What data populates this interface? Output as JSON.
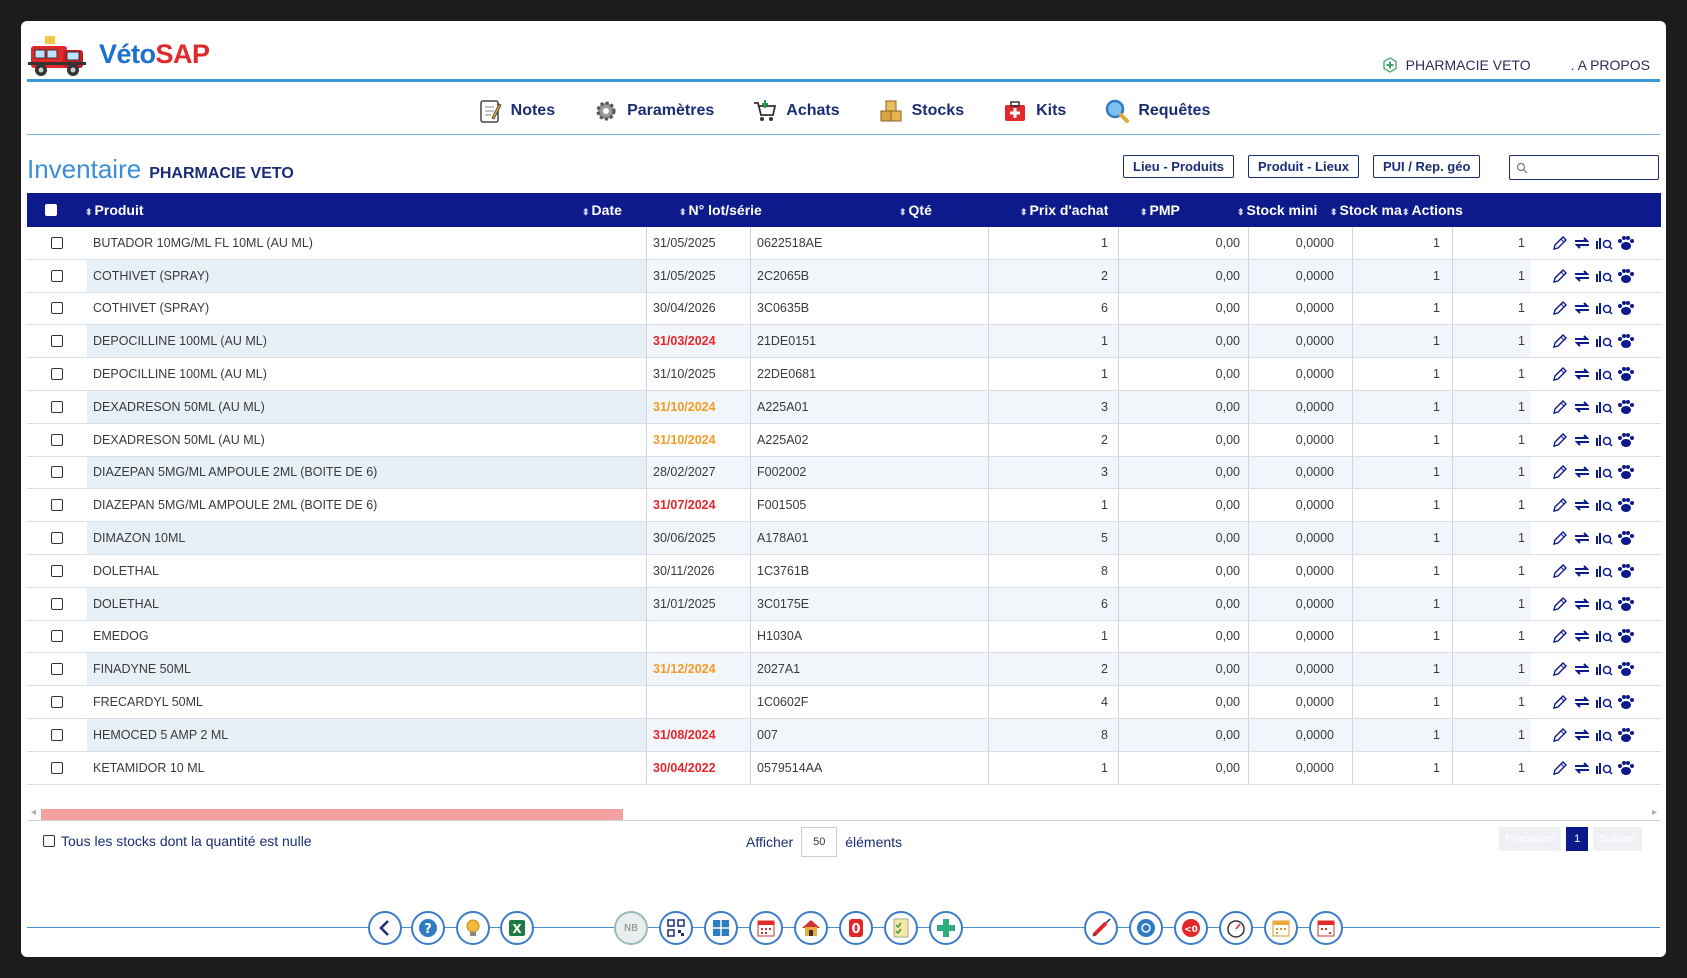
{
  "app": {
    "logo_a": "Véto",
    "logo_b": "SAP"
  },
  "top_links": {
    "pharmacy": "PHARMACIE VETO",
    "about": ". A PROPOS"
  },
  "nav": [
    {
      "label": "Notes",
      "icon": "notepad-icon"
    },
    {
      "label": "Paramètres",
      "icon": "gear-icon"
    },
    {
      "label": "Achats",
      "icon": "cart-icon"
    },
    {
      "label": "Stocks",
      "icon": "boxes-icon"
    },
    {
      "label": "Kits",
      "icon": "first-aid-kit-icon"
    },
    {
      "label": "Requêtes",
      "icon": "magnifier-icon"
    }
  ],
  "page": {
    "title": "Inventaire",
    "subtitle": "PHARMACIE VETO"
  },
  "toolbar_buttons": {
    "lieu_produits": "Lieu - Produits",
    "produit_lieux": "Produit - Lieux",
    "pui": "PUI / Rep. géo"
  },
  "search": {
    "placeholder": ""
  },
  "columns": [
    "Produit",
    "Date",
    "N° lot/série",
    "Qté",
    "Prix d'achat",
    "PMP",
    "Stock mini",
    "Stock ma:",
    "Actions"
  ],
  "rows": [
    {
      "produit": "BUTADOR 10MG/ML FL 10ML (AU ML)",
      "date": "31/05/2025",
      "date_status": "normal",
      "lot": "0622518AE",
      "qte": "1",
      "prix": "0,00",
      "pmp": "0,0000",
      "smin": "1",
      "smax": "1"
    },
    {
      "produit": "COTHIVET (SPRAY)",
      "date": "31/05/2025",
      "date_status": "normal",
      "lot": "2C2065B",
      "qte": "2",
      "prix": "0,00",
      "pmp": "0,0000",
      "smin": "1",
      "smax": "1"
    },
    {
      "produit": "COTHIVET (SPRAY)",
      "date": "30/04/2026",
      "date_status": "normal",
      "lot": "3C0635B",
      "qte": "6",
      "prix": "0,00",
      "pmp": "0,0000",
      "smin": "1",
      "smax": "1"
    },
    {
      "produit": "DEPOCILLINE 100ML (AU ML)",
      "date": "31/03/2024",
      "date_status": "expired",
      "lot": "21DE0151",
      "qte": "1",
      "prix": "0,00",
      "pmp": "0,0000",
      "smin": "1",
      "smax": "1"
    },
    {
      "produit": "DEPOCILLINE 100ML (AU ML)",
      "date": "31/10/2025",
      "date_status": "normal",
      "lot": "22DE0681",
      "qte": "1",
      "prix": "0,00",
      "pmp": "0,0000",
      "smin": "1",
      "smax": "1"
    },
    {
      "produit": "DEXADRESON 50ML (AU ML)",
      "date": "31/10/2024",
      "date_status": "warning",
      "lot": "A225A01",
      "qte": "3",
      "prix": "0,00",
      "pmp": "0,0000",
      "smin": "1",
      "smax": "1"
    },
    {
      "produit": "DEXADRESON 50ML (AU ML)",
      "date": "31/10/2024",
      "date_status": "warning",
      "lot": "A225A02",
      "qte": "2",
      "prix": "0,00",
      "pmp": "0,0000",
      "smin": "1",
      "smax": "1"
    },
    {
      "produit": "DIAZEPAN 5MG/ML AMPOULE 2ML (BOITE DE 6)",
      "date": "28/02/2027",
      "date_status": "normal",
      "lot": "F002002",
      "qte": "3",
      "prix": "0,00",
      "pmp": "0,0000",
      "smin": "1",
      "smax": "1"
    },
    {
      "produit": "DIAZEPAN 5MG/ML AMPOULE 2ML (BOITE DE 6)",
      "date": "31/07/2024",
      "date_status": "expired",
      "lot": "F001505",
      "qte": "1",
      "prix": "0,00",
      "pmp": "0,0000",
      "smin": "1",
      "smax": "1"
    },
    {
      "produit": "DIMAZON 10ML",
      "date": "30/06/2025",
      "date_status": "normal",
      "lot": "A178A01",
      "qte": "5",
      "prix": "0,00",
      "pmp": "0,0000",
      "smin": "1",
      "smax": "1"
    },
    {
      "produit": "DOLETHAL",
      "date": "30/11/2026",
      "date_status": "normal",
      "lot": "1C3761B",
      "qte": "8",
      "prix": "0,00",
      "pmp": "0,0000",
      "smin": "1",
      "smax": "1"
    },
    {
      "produit": "DOLETHAL",
      "date": "31/01/2025",
      "date_status": "normal",
      "lot": "3C0175E",
      "qte": "6",
      "prix": "0,00",
      "pmp": "0,0000",
      "smin": "1",
      "smax": "1"
    },
    {
      "produit": "EMEDOG",
      "date": "",
      "date_status": "normal",
      "lot": "H1030A",
      "qte": "1",
      "prix": "0,00",
      "pmp": "0,0000",
      "smin": "1",
      "smax": "1"
    },
    {
      "produit": "FINADYNE 50ML",
      "date": "31/12/2024",
      "date_status": "warning",
      "lot": "2027A1",
      "qte": "2",
      "prix": "0,00",
      "pmp": "0,0000",
      "smin": "1",
      "smax": "1"
    },
    {
      "produit": "FRECARDYL 50ML",
      "date": "",
      "date_status": "normal",
      "lot": "1C0602F",
      "qte": "4",
      "prix": "0,00",
      "pmp": "0,0000",
      "smin": "1",
      "smax": "1"
    },
    {
      "produit": "HEMOCED 5 AMP 2 ML",
      "date": "31/08/2024",
      "date_status": "expired",
      "lot": "007",
      "qte": "8",
      "prix": "0,00",
      "pmp": "0,0000",
      "smin": "1",
      "smax": "1"
    },
    {
      "produit": "KETAMIDOR 10 ML",
      "date": "30/04/2022",
      "date_status": "expired",
      "lot": "0579514AA",
      "qte": "1",
      "prix": "0,00",
      "pmp": "0,0000",
      "smin": "1",
      "smax": "1"
    }
  ],
  "footer": {
    "zero_stock_label": "Tous les stocks dont la quantité est nulle",
    "show_prefix": "Afficher",
    "show_value": "50",
    "show_suffix": "éléments",
    "prev": "Précédent",
    "page": "1",
    "next": "Suivant"
  },
  "bottom_toolbar": {
    "nb_label": "NB",
    "alert_label": "0",
    "icons_left": [
      "back-icon",
      "help-icon",
      "lightbulb-icon",
      "excel-icon"
    ],
    "icons_mid": [
      "nb-icon",
      "qrcode-icon",
      "grid-icon",
      "calendar-icon",
      "house-icon",
      "zero-alert-icon",
      "checklist-icon",
      "add-icon"
    ],
    "icons_right": [
      "syringe-icon",
      "location-icon",
      "below-zero-icon",
      "gauge-icon",
      "calendar-yellow-icon",
      "calendar-red-icon"
    ]
  },
  "colors": {
    "header_bg": "#0c1a8b",
    "accent": "#3a8fd6",
    "expired": "#e8262b",
    "warning": "#f39c23",
    "logo_red": "#e1282b"
  }
}
